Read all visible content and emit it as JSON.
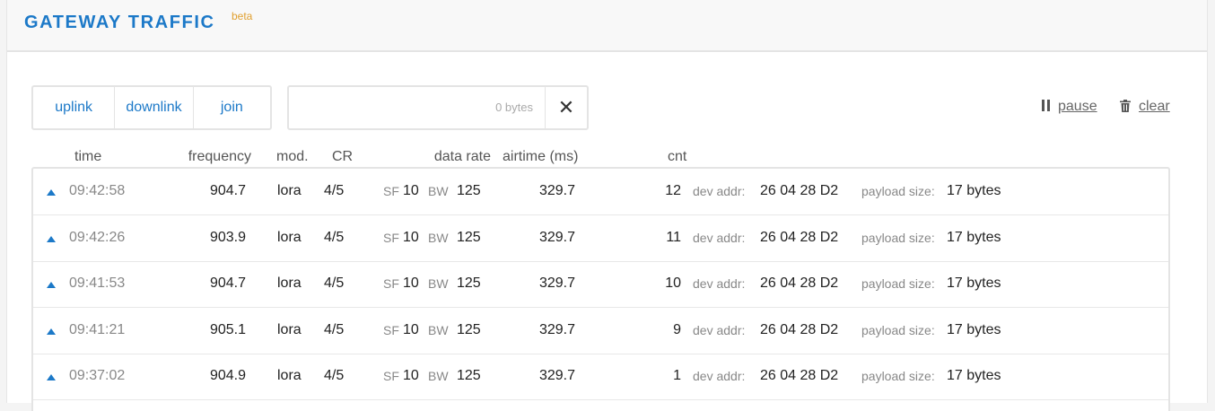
{
  "header": {
    "title": "GATEWAY TRAFFIC",
    "beta": "beta"
  },
  "filters": [
    {
      "label": "uplink"
    },
    {
      "label": "downlink"
    },
    {
      "label": "join"
    }
  ],
  "search": {
    "value": "",
    "placeholder": "",
    "bytes": "0 bytes"
  },
  "actions": {
    "pause_label": "pause",
    "pause_icon": "pause-icon",
    "clear_label": "clear",
    "clear_icon": "trash-icon"
  },
  "columns": {
    "time": "time",
    "frequency": "frequency",
    "mod": "mod.",
    "cr": "CR",
    "data_rate": "data rate",
    "airtime": "airtime (ms)",
    "cnt": "cnt"
  },
  "labels": {
    "sf": "SF",
    "bw": "BW",
    "dev_addr": "dev addr:",
    "payload_size": "payload size:"
  },
  "colors": {
    "accent": "#1c79c8",
    "beta": "#e0a030"
  },
  "rows": [
    {
      "direction": "uplink",
      "time": "09:42:58",
      "frequency": "904.7",
      "mod": "lora",
      "cr": "4/5",
      "sf": "10",
      "bw": "125",
      "airtime": "329.7",
      "cnt": "12",
      "dev_addr": "26 04 28 D2",
      "payload_size": "17 bytes"
    },
    {
      "direction": "uplink",
      "time": "09:42:26",
      "frequency": "903.9",
      "mod": "lora",
      "cr": "4/5",
      "sf": "10",
      "bw": "125",
      "airtime": "329.7",
      "cnt": "11",
      "dev_addr": "26 04 28 D2",
      "payload_size": "17 bytes"
    },
    {
      "direction": "uplink",
      "time": "09:41:53",
      "frequency": "904.7",
      "mod": "lora",
      "cr": "4/5",
      "sf": "10",
      "bw": "125",
      "airtime": "329.7",
      "cnt": "10",
      "dev_addr": "26 04 28 D2",
      "payload_size": "17 bytes"
    },
    {
      "direction": "uplink",
      "time": "09:41:21",
      "frequency": "905.1",
      "mod": "lora",
      "cr": "4/5",
      "sf": "10",
      "bw": "125",
      "airtime": "329.7",
      "cnt": "9",
      "dev_addr": "26 04 28 D2",
      "payload_size": "17 bytes"
    },
    {
      "direction": "uplink",
      "time": "09:37:02",
      "frequency": "904.9",
      "mod": "lora",
      "cr": "4/5",
      "sf": "10",
      "bw": "125",
      "airtime": "329.7",
      "cnt": "1",
      "dev_addr": "26 04 28 D2",
      "payload_size": "17 bytes"
    }
  ]
}
